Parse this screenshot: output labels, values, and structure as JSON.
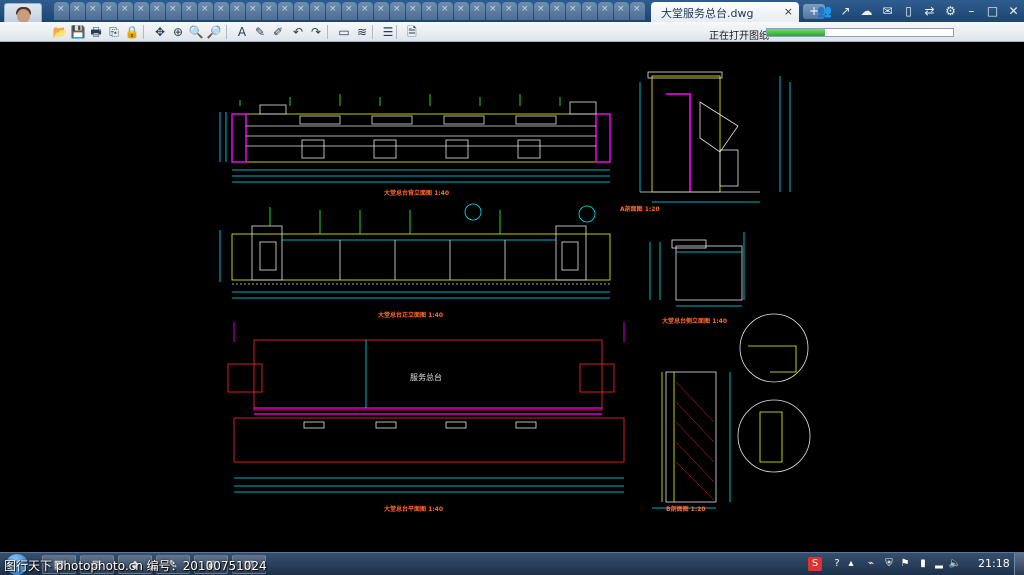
{
  "window": {
    "active_tab_title": "大堂服务总台.dwg",
    "tab_close_glyph": "×",
    "new_tab_glyph": "+",
    "inactive_tab_count": 37
  },
  "title_bar_icons": [
    {
      "name": "users-icon",
      "glyph": "👥"
    },
    {
      "name": "share-icon",
      "glyph": "↗"
    },
    {
      "name": "cloud-icon",
      "glyph": "☁"
    },
    {
      "name": "chat-icon",
      "glyph": "✉"
    },
    {
      "name": "phone-icon",
      "glyph": "▯"
    },
    {
      "name": "switch-icon",
      "glyph": "⇄"
    },
    {
      "name": "settings-icon",
      "glyph": "⚙"
    },
    {
      "name": "minimize-icon",
      "glyph": "–"
    },
    {
      "name": "maximize-icon",
      "glyph": "□"
    },
    {
      "name": "close-window-icon",
      "glyph": "✕"
    }
  ],
  "toolbar": {
    "tools": [
      {
        "name": "open-folder-icon",
        "glyph": "📂"
      },
      {
        "name": "save-icon",
        "glyph": "💾"
      },
      {
        "name": "print-icon",
        "glyph": "🖶"
      },
      {
        "name": "export-pdf-icon",
        "glyph": "⎘"
      },
      {
        "name": "lock-icon",
        "glyph": "🔒"
      },
      {
        "name": "pan-icon",
        "glyph": "✥"
      },
      {
        "name": "zoom-extents-icon",
        "glyph": "⊕"
      },
      {
        "name": "zoom-in-icon",
        "glyph": "🔍"
      },
      {
        "name": "zoom-out-icon",
        "glyph": "🔎"
      },
      {
        "name": "text-icon",
        "glyph": "A"
      },
      {
        "name": "pen-icon",
        "glyph": "✎"
      },
      {
        "name": "brush-icon",
        "glyph": "✐"
      },
      {
        "name": "undo-icon",
        "glyph": "↶"
      },
      {
        "name": "redo-icon",
        "glyph": "↷"
      },
      {
        "name": "measure-icon",
        "glyph": "▭"
      },
      {
        "name": "dimension-icon",
        "glyph": "≋"
      },
      {
        "name": "layers-icon",
        "glyph": "☰"
      },
      {
        "name": "properties-icon",
        "glyph": "🗎"
      }
    ],
    "status_text": "正在打开图纸",
    "progress": 0.31
  },
  "drawing": {
    "captions": {
      "back_elevation": "大堂总台背立面图 1:40",
      "front_elevation": "大堂总台正立面图 1:40",
      "plan": "大堂总台平面图 1:40",
      "section_a": "A剖面图 1:20",
      "side_elevation": "大堂总台侧立面图 1:40",
      "section_b": "B剖面图 1:20"
    },
    "plan_center_label": "服务总台",
    "colors": {
      "cyan": "#00e5ff",
      "yellow": "#f6ff00",
      "magenta": "#ff00ff",
      "red": "#ff2a2a",
      "white": "#e6e6e6",
      "green": "#3cff3c",
      "orange": "#ff6a2b"
    }
  },
  "taskbar": {
    "watermark": "图行天下 photophoto.cn  编号：20100751024",
    "clock": "21:18",
    "tray_icons": [
      {
        "name": "antivirus-tray-icon",
        "glyph": "S"
      },
      {
        "name": "help-tray-icon",
        "glyph": "?"
      },
      {
        "name": "expand-tray-icon",
        "glyph": "▴"
      },
      {
        "name": "network-tray-icon",
        "glyph": "⌁"
      },
      {
        "name": "shield-tray-icon",
        "glyph": "⛨"
      },
      {
        "name": "flag-tray-icon",
        "glyph": "⚑"
      },
      {
        "name": "battery-tray-icon",
        "glyph": "▮"
      },
      {
        "name": "signal-tray-icon",
        "glyph": "▂"
      },
      {
        "name": "volume-tray-icon",
        "glyph": "🔈"
      }
    ]
  }
}
